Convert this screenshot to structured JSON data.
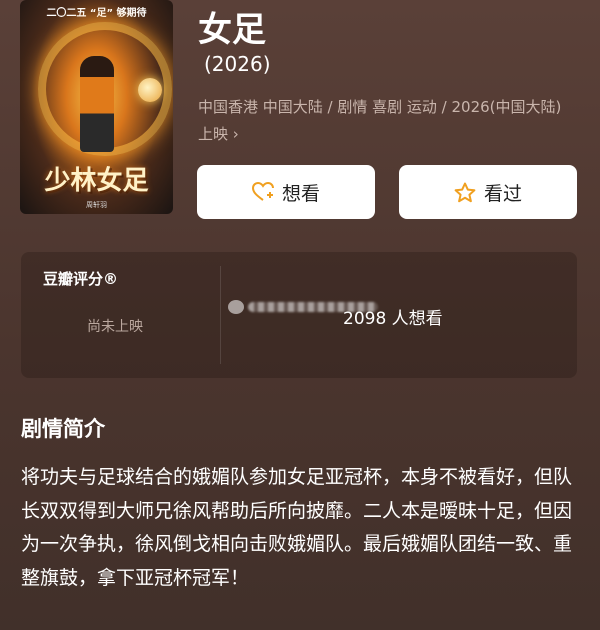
{
  "poster": {
    "top_text": "二〇二五 “足” 够期待",
    "title_art": "少林女足",
    "credit": "周轩羽"
  },
  "movie": {
    "title": "女足",
    "year": "(2026)",
    "meta": "中国香港 中国大陆 / 剧情 喜剧 运动 / 2026(中国大陆) 上映 ›"
  },
  "actions": {
    "want_label": "想看",
    "seen_label": "看过",
    "want_icon": "heart-plus-icon",
    "seen_icon": "star-outline-icon",
    "icon_color": "#f0a020"
  },
  "rating": {
    "label": "豆瓣评分®",
    "status": "尚未上映",
    "wish_count": "2098 人想看"
  },
  "synopsis": {
    "heading": "剧情简介",
    "text": "将功夫与足球结合的娥媚队参加女足亚冠杯，本身不被看好，但队长双双得到大师兄徐风帮助后所向披靡。二人本是暧昧十足，但因为一次争执，徐风倒戈相向击败娥媚队。最后娥媚队团结一致、重整旗鼓，拿下亚冠杯冠军！"
  }
}
